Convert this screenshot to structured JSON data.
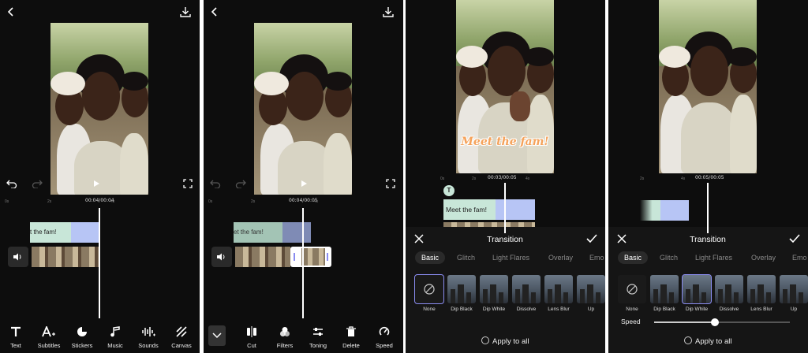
{
  "panel1": {
    "timecode": "00:04/00:04",
    "ruler": [
      "0s",
      "2s",
      "4s"
    ],
    "text_clip": "t the fam!",
    "toolbar": [
      "Text",
      "Subtitles",
      "Stickers",
      "Music",
      "Sounds",
      "Canvas"
    ]
  },
  "panel2": {
    "timecode": "00:04/00:05",
    "ruler": [
      "0s",
      "2s",
      "4s"
    ],
    "text_clip": "et the fam!",
    "toolbar": [
      "Cut",
      "Filters",
      "Toning",
      "Delete",
      "Speed"
    ]
  },
  "panel3": {
    "overlay_text": "Meet the fam!",
    "timecode": "00:03/00:05",
    "ruler": [
      "0s",
      "2s",
      "4s"
    ],
    "text_badge": "T",
    "text_clip": "Meet the fam!",
    "header_title": "Transition",
    "tabs": [
      "Basic",
      "Glitch",
      "Light Flares",
      "Overlay",
      "Emo"
    ],
    "transitions": [
      "None",
      "Dip Black",
      "Dip White",
      "Dissolve",
      "Lens Blur",
      "Up"
    ],
    "apply_label": "Apply to all"
  },
  "panel4": {
    "timecode": "00:05/00:05",
    "ruler": [
      "2s",
      "4s"
    ],
    "header_title": "Transition",
    "tabs": [
      "Basic",
      "Glitch",
      "Light Flares",
      "Overlay",
      "Emo"
    ],
    "transitions": [
      "None",
      "Dip Black",
      "Dip White",
      "Dissolve",
      "Lens Blur",
      "Up"
    ],
    "speed_label": "Speed",
    "speed_value": 0.45,
    "apply_label": "Apply to all"
  },
  "colors": {
    "background": "#0d0d0d",
    "text_clip_green": "#c8e6d8",
    "video_clip_blue": "#b7c5f5",
    "selection_purple": "#8a8cf0",
    "overlay_text_orange": "#f5a25a"
  }
}
